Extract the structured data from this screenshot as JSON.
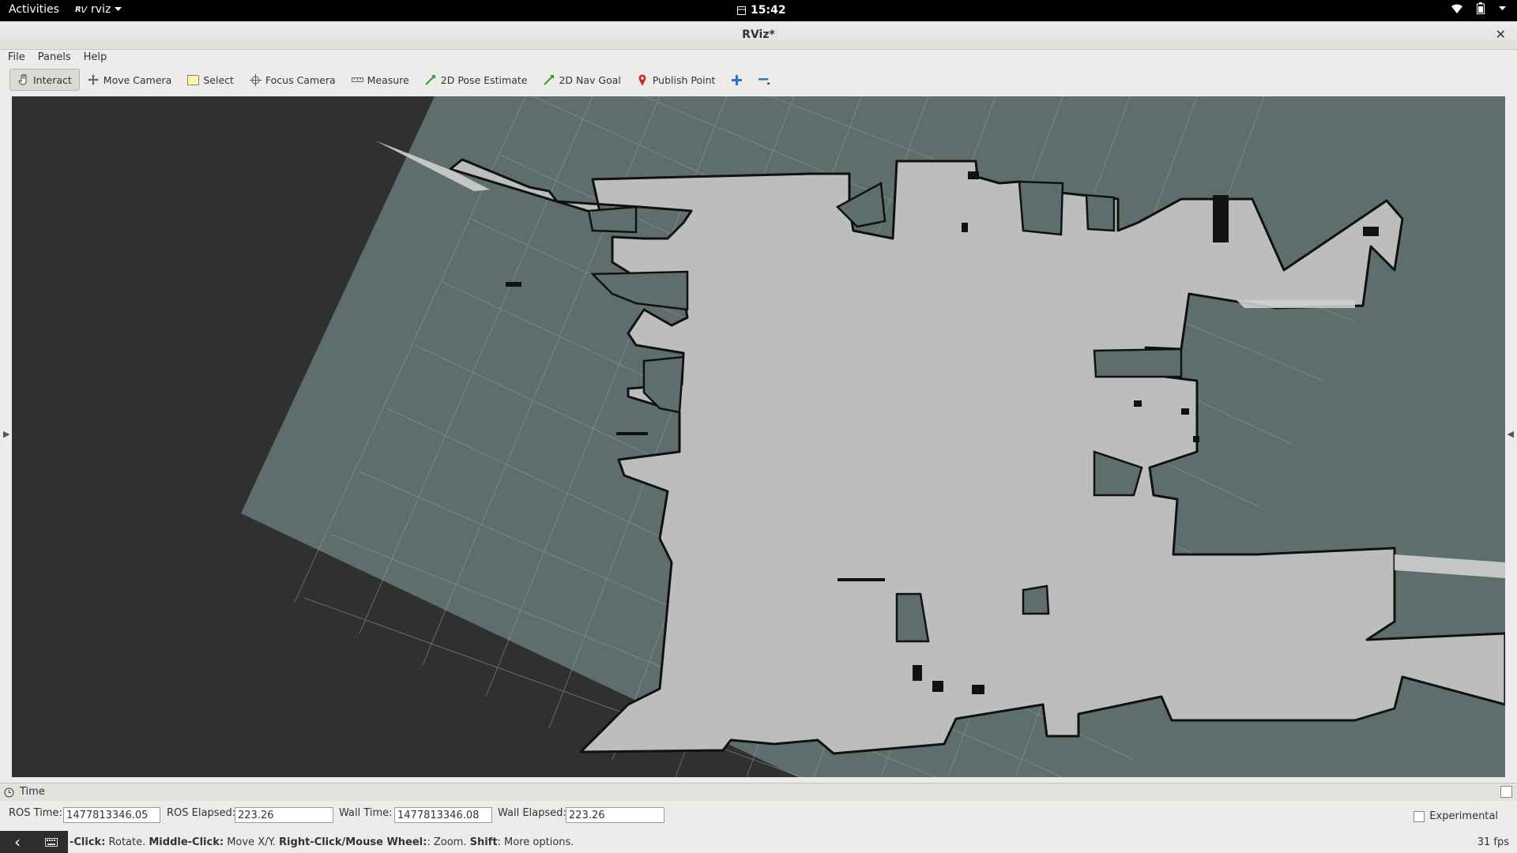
{
  "topbar": {
    "activities": "Activities",
    "app_name": "rviz",
    "app_logo": "R\\/",
    "clock": "15:42",
    "icons": [
      "wifi-icon",
      "battery-icon",
      "chevron-down-icon"
    ]
  },
  "window": {
    "title": "RViz*"
  },
  "menu": {
    "file": "File",
    "panels": "Panels",
    "help": "Help"
  },
  "toolbar": {
    "interact": "Interact",
    "move_camera": "Move Camera",
    "select": "Select",
    "focus_camera": "Focus Camera",
    "measure": "Measure",
    "pose_estimate": "2D Pose Estimate",
    "nav_goal": "2D Nav Goal",
    "publish_point": "Publish Point",
    "active_tool": "Interact",
    "accent_green": "#2ca02c",
    "marker_red": "#cc2b1d"
  },
  "map": {
    "background": "#303030",
    "unknown_color": "#5e6e6c",
    "free_color": "#bdbdbd",
    "obstacle_color": "#111111",
    "grid_color": "#a8a8a8"
  },
  "time_panel": {
    "title": "Time",
    "ros_time_label": "ROS Time:",
    "ros_time": "1477813346.05",
    "ros_elapsed_label": "ROS Elapsed:",
    "ros_elapsed": "223.26",
    "wall_time_label": "Wall Time:",
    "wall_time": "1477813346.08",
    "wall_elapsed_label": "Wall Elapsed:",
    "wall_elapsed": "223.26",
    "experimental": "Experimental"
  },
  "status": {
    "hint_part1": "-Click:",
    "hint_part2": " Rotate. ",
    "hint_part3": "Middle-Click:",
    "hint_part4": " Move X/Y. ",
    "hint_part5": "Right-Click/Mouse Wheel:",
    "hint_part6": ": Zoom. ",
    "hint_part7": "Shift",
    "hint_part8": ": More options.",
    "fps": "31 fps"
  }
}
